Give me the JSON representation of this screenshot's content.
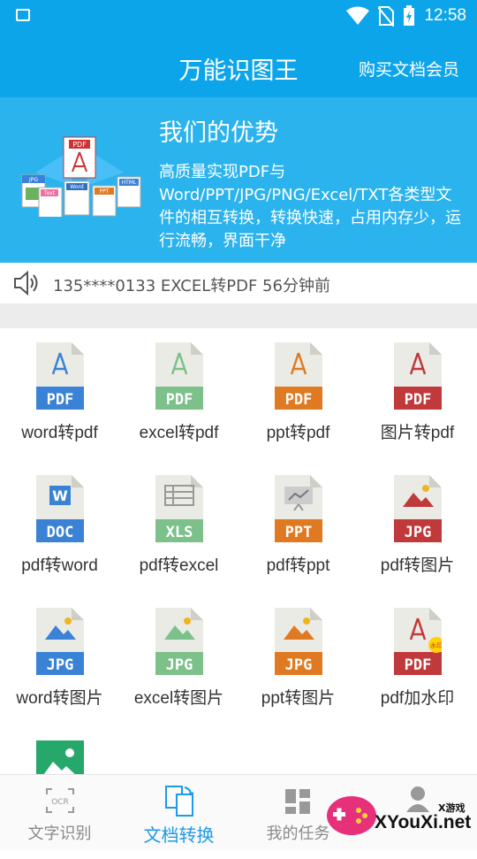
{
  "status": {
    "time": "12:58"
  },
  "header": {
    "title": "万能识图王",
    "member_link": "购买文档会员"
  },
  "banner": {
    "title": "我们的优势",
    "desc": "高质量实现PDF与Word/PPT/JPG/PNG/Excel/TXT各类型文件的相互转换，转换快速，占用内存少，运行流畅，界面干净",
    "illustration_tags": [
      "PDF",
      "JPG",
      "Text",
      "Word",
      "PPT",
      "HTML"
    ]
  },
  "notice": {
    "text": "135****0133  EXCEL转PDF  56分钟前"
  },
  "tools": [
    {
      "label": "word转pdf",
      "badge": "PDF",
      "color": "#3a82d6",
      "glyph": "pdf"
    },
    {
      "label": "excel转pdf",
      "badge": "PDF",
      "color": "#7cc08a",
      "glyph": "pdf"
    },
    {
      "label": "ppt转pdf",
      "badge": "PDF",
      "color": "#e07a22",
      "glyph": "pdf"
    },
    {
      "label": "图片转pdf",
      "badge": "PDF",
      "color": "#c0393b",
      "glyph": "pdf"
    },
    {
      "label": "pdf转word",
      "badge": "DOC",
      "color": "#3a82d6",
      "glyph": "w"
    },
    {
      "label": "pdf转excel",
      "badge": "XLS",
      "color": "#7cc08a",
      "glyph": "xls"
    },
    {
      "label": "pdf转ppt",
      "badge": "PPT",
      "color": "#e07a22",
      "glyph": "ppt"
    },
    {
      "label": "pdf转图片",
      "badge": "JPG",
      "color": "#c0393b",
      "glyph": "img"
    },
    {
      "label": "word转图片",
      "badge": "JPG",
      "color": "#3a82d6",
      "glyph": "img"
    },
    {
      "label": "excel转图片",
      "badge": "JPG",
      "color": "#7cc08a",
      "glyph": "img"
    },
    {
      "label": "ppt转图片",
      "badge": "JPG",
      "color": "#e07a22",
      "glyph": "img"
    },
    {
      "label": "pdf加水印",
      "badge": "PDF",
      "color": "#c0393b",
      "glyph": "pdf",
      "stamp": "水印"
    },
    {
      "label": "",
      "badge": "",
      "color": "#26a86a",
      "glyph": "photo"
    }
  ],
  "bottom_nav": [
    {
      "label": "文字识别",
      "icon": "ocr-icon",
      "active": false
    },
    {
      "label": "文档转换",
      "icon": "convert-icon",
      "active": true
    },
    {
      "label": "我的任务",
      "icon": "tasks-icon",
      "active": false
    },
    {
      "label": "",
      "icon": "user-icon",
      "active": false
    }
  ],
  "icon_text": {
    "ocr": "OCR"
  },
  "watermark": {
    "top": "X游戏",
    "site": "XYouXi.net"
  },
  "colors": {
    "primary": "#0da5ea",
    "banner": "#2bb3ee",
    "active_tab": "#1c9be6"
  }
}
